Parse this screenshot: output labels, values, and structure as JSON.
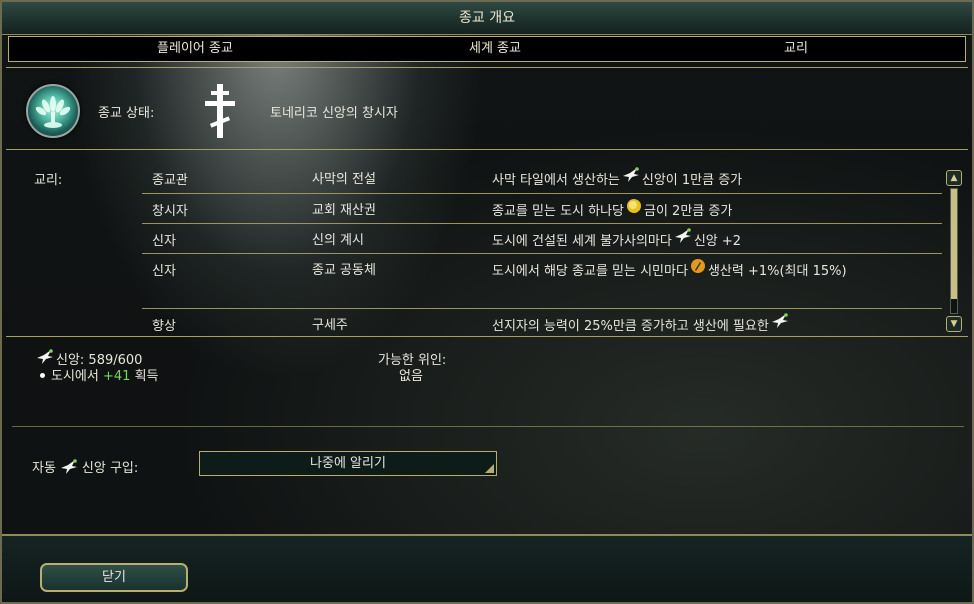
{
  "window": {
    "title": "종교 개요"
  },
  "tabs": [
    {
      "label": "플레이어 종교"
    },
    {
      "label": "세계 종교"
    },
    {
      "label": "교리"
    }
  ],
  "status": {
    "label": "종교 상태:",
    "value": "토네리코 신앙의 창시자",
    "icons": [
      "religion-emblem-icon",
      "orthodox-cross-icon"
    ]
  },
  "beliefs": {
    "label": "교리:",
    "rows": [
      {
        "type": "종교관",
        "name": "사막의 전설",
        "desc_before": "사막 타일에서 생산하는",
        "icon": "faith-icon",
        "desc_after": "신앙이 1만큼 증가"
      },
      {
        "type": "창시자",
        "name": "교회 재산권",
        "desc_before": "종교를 믿는 도시 하나당",
        "icon": "gold-icon",
        "desc_after": "금이 2만큼 증가"
      },
      {
        "type": "신자",
        "name": "신의 계시",
        "desc_before": "도시에 건설된 세계 불가사의마다",
        "icon": "faith-icon",
        "desc_after": "신앙 +2"
      },
      {
        "type": "신자",
        "name": "종교 공동체",
        "desc_before": "도시에서 해당 종교를 믿는 시민마다",
        "icon": "production-icon",
        "desc_after": "생산력 +1%(최대 15%)"
      },
      {
        "type": "향상",
        "name": "구세주",
        "desc_before": "선지자의 능력이 25%만큼 증가하고 생산에 필요한",
        "icon": "faith-icon",
        "desc_after": ""
      }
    ]
  },
  "faith": {
    "label": "신앙: 589/600",
    "income_prefix": "도시에서",
    "income_value": "+41",
    "income_suffix": "획득"
  },
  "possible_cause": {
    "label": "가능한 위인:",
    "value": "없음"
  },
  "auto_purchase": {
    "label_before": "자동",
    "label_after": "신앙 구입:",
    "dropdown_value": "나중에 알리기"
  },
  "close_label": "닫기",
  "colors": {
    "gold_border": "#b8ad70",
    "income_green": "#78d45c",
    "title_bar": "#2f4a44"
  }
}
